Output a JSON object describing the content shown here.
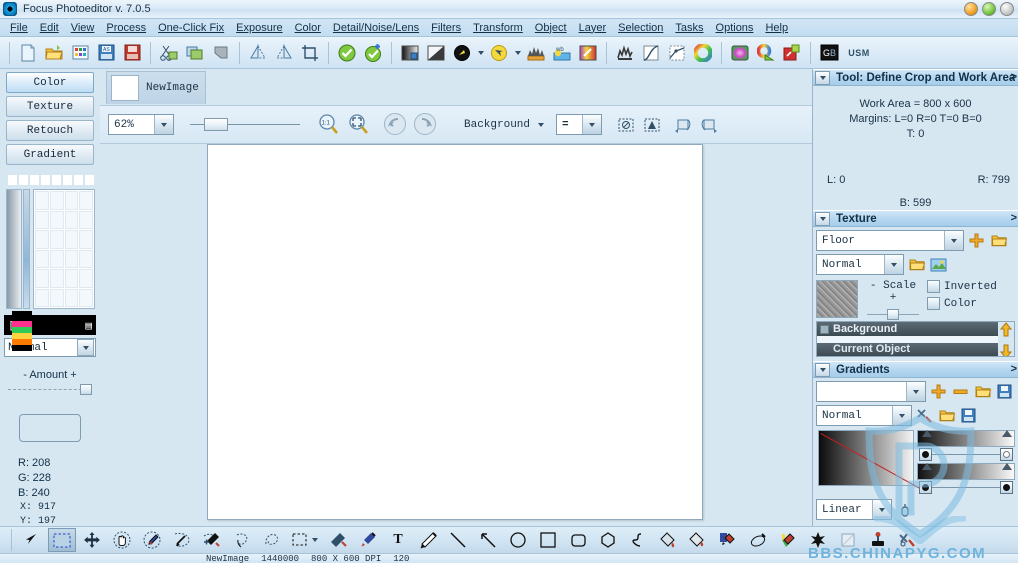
{
  "window": {
    "title": "Focus Photoeditor v. 7.0.5",
    "app_icon": "aperture-icon",
    "buttons": {
      "minimize": "minimize-button",
      "maximize": "maximize-button",
      "close": "close-button"
    }
  },
  "menubar": {
    "items": [
      {
        "label": "File"
      },
      {
        "label": "Edit"
      },
      {
        "label": "View"
      },
      {
        "label": "Process"
      },
      {
        "label": "One-Click Fix"
      },
      {
        "label": "Exposure"
      },
      {
        "label": "Color"
      },
      {
        "label": "Detail/Noise/Lens"
      },
      {
        "label": "Filters"
      },
      {
        "label": "Transform"
      },
      {
        "label": "Object"
      },
      {
        "label": "Layer"
      },
      {
        "label": "Selection"
      },
      {
        "label": "Tasks"
      },
      {
        "label": "Options"
      },
      {
        "label": "Help"
      }
    ]
  },
  "toolbar": {
    "groups": [
      [
        "new-document-icon",
        "open-folder-icon",
        "color-table-icon",
        "save-as-icon",
        "save-icon"
      ],
      [
        "cut-icon",
        "copy-icon",
        "paste-icon"
      ],
      [
        "flip-horizontal-icon",
        "flip-vertical-icon",
        "crop-icon"
      ],
      [
        "one-click-fix-icon",
        "add-fix-icon"
      ],
      [
        "levels-icon",
        "contrast-icon",
        "brightness-icon",
        "shadow-highlight-icon",
        "white-balance-icon",
        "color-cast-icon"
      ],
      [
        "histogram-icon",
        "curves-icon",
        "tone-curve-icon",
        "color-wheel-icon"
      ],
      [
        "hue-saturation-icon",
        "color-mixer-icon",
        "color-replace-icon"
      ],
      [
        "grayscale-icon",
        "usm-icon"
      ]
    ],
    "usm_label": "USM"
  },
  "left_panel": {
    "tabs": [
      {
        "label": "Color",
        "active": true
      },
      {
        "label": "Texture",
        "active": false
      },
      {
        "label": "Retouch",
        "active": false
      },
      {
        "label": "Gradient",
        "active": false
      }
    ],
    "blend_mode": "Normal",
    "amount_label": "- Amount +",
    "readout": {
      "r": "R: 208",
      "g": "G: 228",
      "b": "B: 240",
      "x": "X:  917",
      "y": "Y:  197"
    },
    "icons": {
      "marker": "crop-marks-icon",
      "list": "list-icon",
      "dropdown": "chevron-down-icon"
    }
  },
  "document": {
    "tab_label": "NewImage",
    "thumbnail": "document-thumbnail"
  },
  "options_bar": {
    "zoom_value": "62%",
    "zoom_actual_icon": "zoom-actual-size-icon",
    "zoom_fit_icon": "zoom-fit-icon",
    "nav_back_icon": "nav-back-icon",
    "nav_forward_icon": "nav-forward-icon",
    "target_label": "Background",
    "blend_symbol": "=",
    "extra_icons": [
      "selection-toggle-icon",
      "mask-icon",
      "rotate-left-icon",
      "rotate-right-icon"
    ]
  },
  "right_dock": {
    "panels": [
      {
        "id": "tool-panel",
        "title": "Tool: Define Crop and Work Area",
        "expand_glyph": ">",
        "lines": {
          "work_area": "Work Area = 800 x 600",
          "margins": "Margins: L=0 R=0 T=0 B=0",
          "top": "T: 0",
          "left": "L: 0",
          "right": "R: 799",
          "bottom": "B: 599"
        }
      },
      {
        "id": "texture-panel",
        "title": "Texture",
        "expand_glyph": ">",
        "texture_name": "Floor",
        "blend_mode": "Normal",
        "scale_label": "- Scale +",
        "checkboxes": [
          {
            "label": "Inverted",
            "checked": false
          },
          {
            "label": "Color",
            "checked": false
          }
        ],
        "icons": [
          "add-icon",
          "open-folder-icon",
          "load-texture-icon",
          "texture-image-icon"
        ]
      },
      {
        "id": "layers-panel",
        "layer_name": "Background",
        "current_object_label": "Current Object",
        "icons": [
          "move-up-icon",
          "move-down-icon"
        ]
      },
      {
        "id": "gradients-panel",
        "title": "Gradients",
        "expand_glyph": ">",
        "gradient_name": "",
        "blend_mode": "Normal",
        "gradient_type": "Linear",
        "icons": [
          "add-icon",
          "remove-icon",
          "open-folder-icon",
          "save-icon",
          "edit-icon",
          "tools-icon",
          "link-icon"
        ]
      }
    ]
  },
  "bottom_tools": {
    "tools": [
      {
        "name": "pointer-tool",
        "selected": false
      },
      {
        "name": "rectangle-select-tool",
        "selected": true
      },
      {
        "name": "move-tool",
        "selected": false
      },
      {
        "name": "hand-tool",
        "selected": false
      },
      {
        "name": "eyedropper-select-tool",
        "selected": false
      },
      {
        "name": "magic-wand-tool",
        "selected": false
      },
      {
        "name": "magic-brush-tool",
        "selected": false
      },
      {
        "name": "lasso-tool",
        "selected": false
      },
      {
        "name": "freehand-lasso-tool",
        "selected": false
      },
      {
        "name": "marquee-options-tool",
        "selected": false
      },
      {
        "name": "clone-stamp-tool",
        "selected": false
      },
      {
        "name": "eyedropper-tool",
        "selected": false
      },
      {
        "name": "text-tool",
        "selected": false
      },
      {
        "name": "pencil-tool",
        "selected": false
      },
      {
        "name": "line-tool",
        "selected": false
      },
      {
        "name": "arrow-tool",
        "selected": false
      },
      {
        "name": "ellipse-tool",
        "selected": false
      },
      {
        "name": "rectangle-tool",
        "selected": false
      },
      {
        "name": "rounded-rectangle-tool",
        "selected": false
      },
      {
        "name": "polygon-tool",
        "selected": false
      },
      {
        "name": "curve-tool",
        "selected": false
      },
      {
        "name": "paint-bucket-tool",
        "selected": false
      },
      {
        "name": "gradient-fill-tool",
        "selected": false
      },
      {
        "name": "red-eye-tool",
        "selected": false
      },
      {
        "name": "blur-tool",
        "selected": false
      },
      {
        "name": "paintbrush-tool",
        "selected": false
      },
      {
        "name": "effects-tool",
        "selected": false
      },
      {
        "name": "eraser-tool",
        "selected": false
      },
      {
        "name": "stamp-tool",
        "selected": false
      },
      {
        "name": "repair-tool",
        "selected": false
      }
    ],
    "text_label": "T"
  },
  "statusbar": {
    "name": "NewImage",
    "size": "1440000",
    "dimensions": "800 X 600 DPI",
    "dpi": "120"
  },
  "watermark": {
    "text": "BBS.CHINAPYG.COM",
    "shield": "shield-watermark",
    "color": "#6fb4dd"
  },
  "colors": {
    "panel_bg": "#d6e7f2",
    "header_blue": "#a4cdeb",
    "canvas_white": "#ffffff",
    "readout_rgb": "#1b3245"
  }
}
